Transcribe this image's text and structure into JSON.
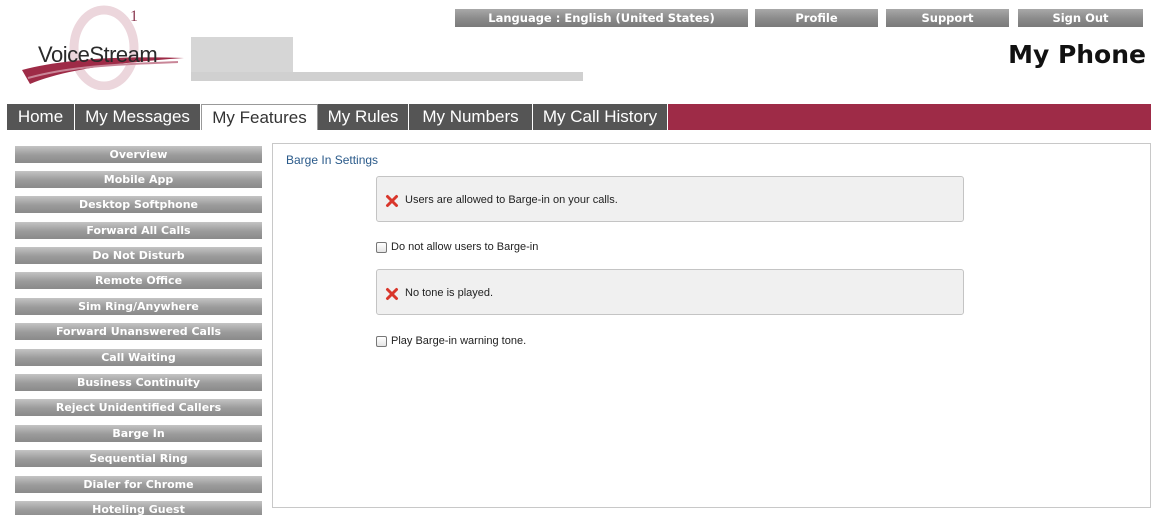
{
  "header": {
    "logo_text": "VoiceStream",
    "logo_superscript": "1",
    "page_heading": "My Phone",
    "top_links": [
      {
        "label": "Language : English (United States)"
      },
      {
        "label": "Profile"
      },
      {
        "label": "Support"
      },
      {
        "label": "Sign Out"
      }
    ]
  },
  "nav": {
    "tabs": [
      {
        "label": "Home",
        "active": false
      },
      {
        "label": "My Messages",
        "active": false
      },
      {
        "label": "My Features",
        "active": true
      },
      {
        "label": "My Rules",
        "active": false
      },
      {
        "label": "My Numbers",
        "active": false
      },
      {
        "label": "My Call History",
        "active": false
      }
    ]
  },
  "sidebar": {
    "items": [
      {
        "label": "Overview"
      },
      {
        "label": "Mobile App"
      },
      {
        "label": "Desktop Softphone"
      },
      {
        "label": "Forward All Calls"
      },
      {
        "label": "Do Not Disturb"
      },
      {
        "label": "Remote Office"
      },
      {
        "label": "Sim Ring/Anywhere"
      },
      {
        "label": "Forward Unanswered Calls"
      },
      {
        "label": "Call Waiting"
      },
      {
        "label": "Business Continuity"
      },
      {
        "label": "Reject Unidentified Callers"
      },
      {
        "label": "Barge In"
      },
      {
        "label": "Sequential Ring"
      },
      {
        "label": "Dialer for Chrome"
      },
      {
        "label": "Hoteling Guest"
      }
    ]
  },
  "panel": {
    "title": "Barge In Settings",
    "barge_status": "Users are allowed to Barge-in on your calls.",
    "barge_checkbox_label": "Do not allow users to Barge-in",
    "barge_checkbox_checked": false,
    "tone_status": "No tone is played.",
    "tone_checkbox_label": "Play Barge-in warning tone.",
    "tone_checkbox_checked": false
  },
  "colors": {
    "nav_bar": "#9e2b47",
    "nav_tab": "#555555",
    "sidebar_button": "#9a9a9a",
    "status_x": "#d9362b",
    "panel_title": "#2a5a8a"
  },
  "icons": {
    "status": "x-mark-icon",
    "logo": "logo-swoosh-icon"
  }
}
